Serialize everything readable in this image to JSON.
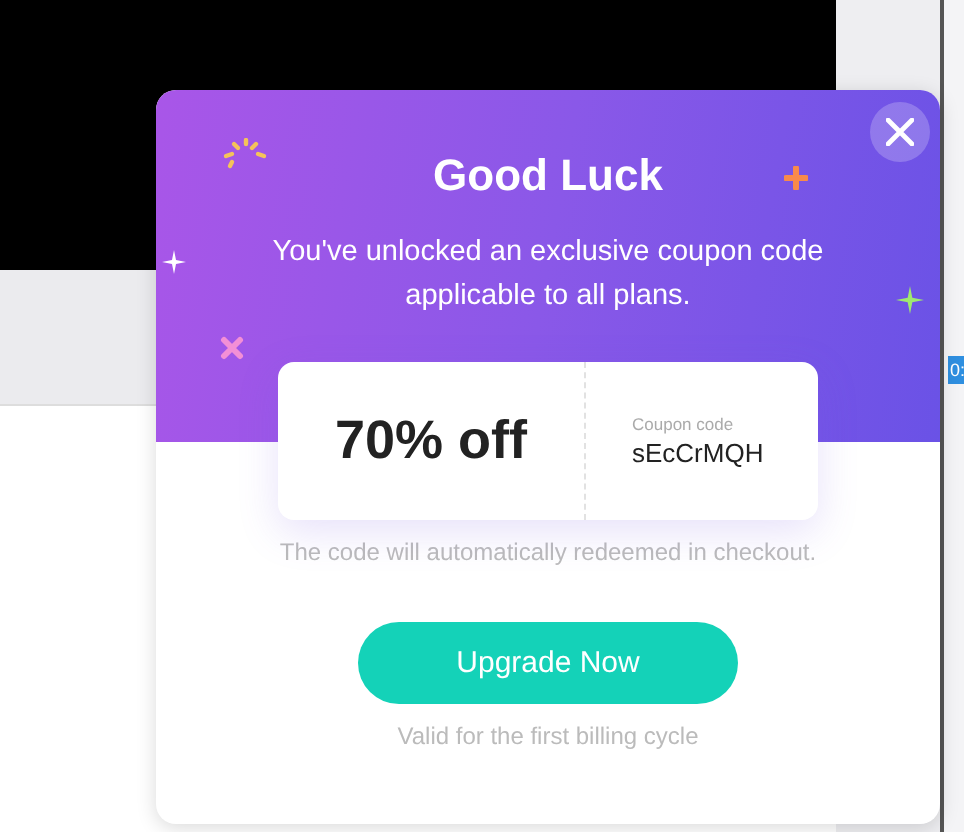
{
  "side_tag": "0:",
  "modal": {
    "title": "Good Luck",
    "message": "You've unlocked an exclusive coupon code applicable to all plans.",
    "coupon": {
      "discount": "70% off",
      "code_label": "Coupon code",
      "code": "sEcCrMQH"
    },
    "note": "The code will automatically redeemed in checkout.",
    "button": "Upgrade Now",
    "footnote": "Valid for the first billing cycle"
  }
}
